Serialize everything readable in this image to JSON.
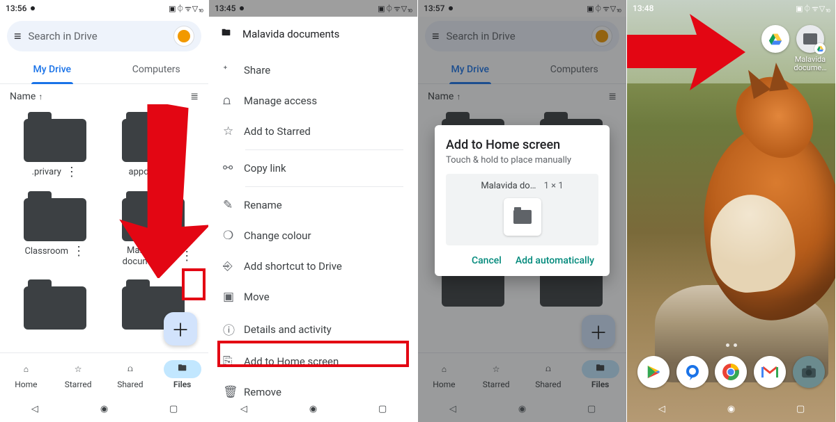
{
  "status_times": [
    "13:56",
    "13:45",
    "13:57",
    "13:48"
  ],
  "status_icons": "▣ ⏀ ᯤ ▽ ⏨",
  "drive": {
    "search_placeholder": "Search in Drive",
    "tabs": [
      "My Drive",
      "Computers"
    ],
    "sort_label": "Name",
    "sort_arrow": "↑",
    "view_icon": "≣",
    "folders": [
      ".privary",
      "appdata",
      "Classroom",
      "Malavida documents"
    ],
    "bottom_tabs": [
      "Home",
      "Starred",
      "Shared",
      "Files"
    ]
  },
  "context_menu": {
    "folder_name": "Malavida documents",
    "items": [
      "Share",
      "Manage access",
      "Add to Starred",
      "Copy link",
      "Rename",
      "Change colour",
      "Add shortcut to Drive",
      "Move",
      "Details and activity",
      "Add to Home screen",
      "Remove"
    ]
  },
  "modal": {
    "title": "Add to Home screen",
    "subtitle": "Touch & hold to place manually",
    "shortcut_name": "Malavida do…",
    "shortcut_size": "1 × 1",
    "cancel": "Cancel",
    "add": "Add automatically"
  },
  "home": {
    "shortcut_label": "Malavida docume…"
  }
}
